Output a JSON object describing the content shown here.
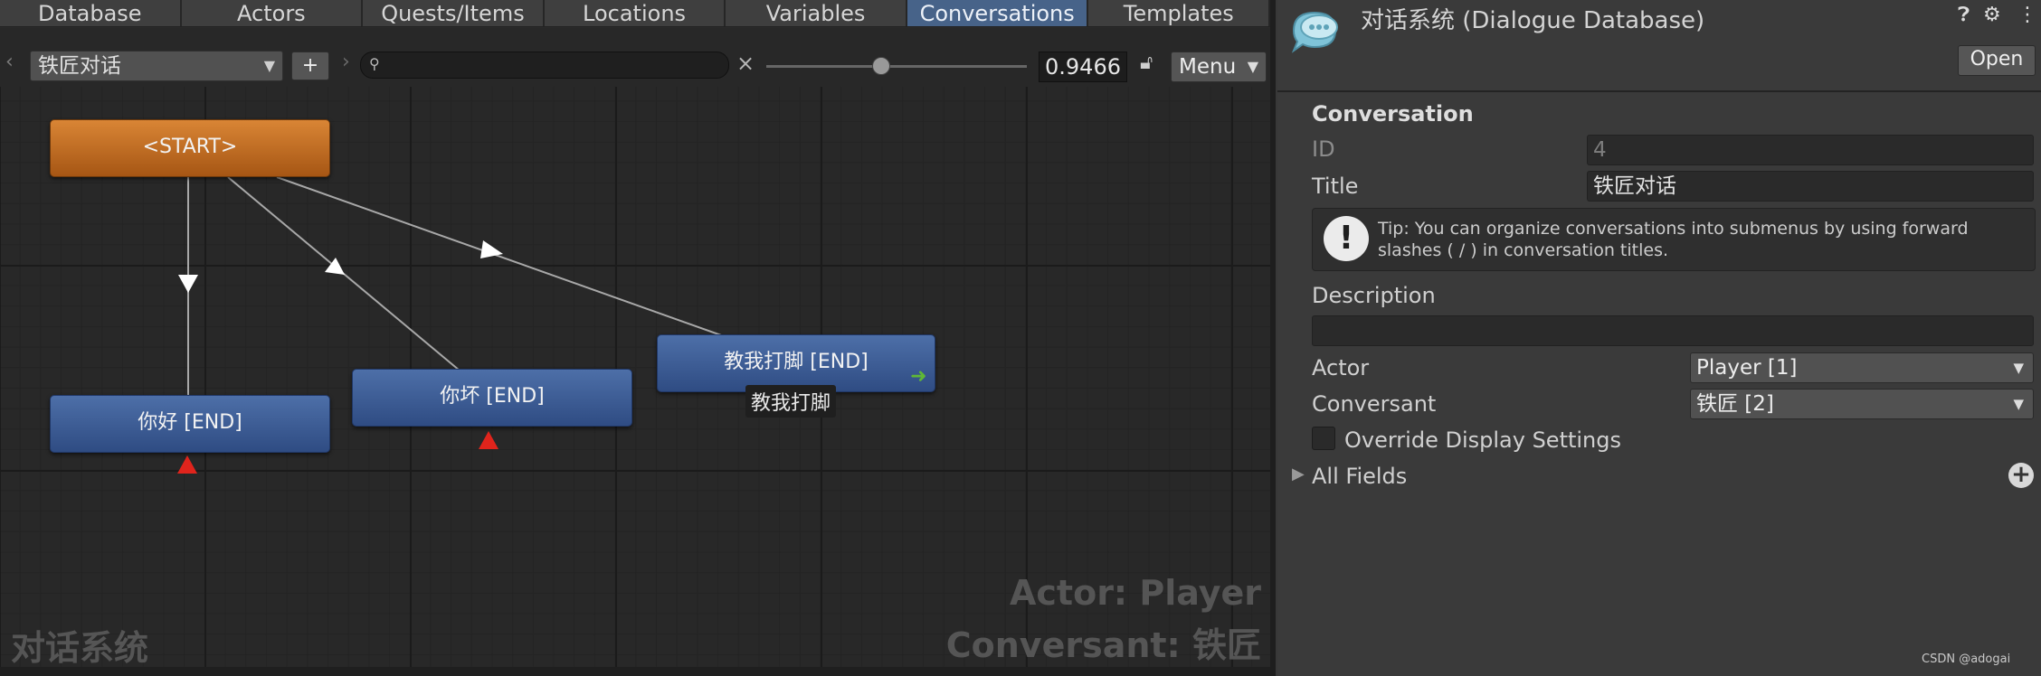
{
  "tabs": [
    "Database",
    "Actors",
    "Quests/Items",
    "Locations",
    "Variables",
    "Conversations",
    "Templates"
  ],
  "active_tab": "Conversations",
  "toolbar": {
    "conversation_title": "铁匠对话",
    "add_label": "+",
    "search_value": "",
    "clear_label": "×",
    "zoom_value": "0.9466",
    "zoom_fraction": 0.44,
    "menu_label": "Menu"
  },
  "canvas": {
    "nodes": [
      {
        "id": "start",
        "label": "<START>",
        "kind": "start"
      },
      {
        "id": "n1",
        "label": "你好 [END]",
        "kind": "end"
      },
      {
        "id": "n2",
        "label": "你坏 [END]",
        "kind": "end"
      },
      {
        "id": "n3",
        "label": "教我打脚 [END]",
        "kind": "end"
      }
    ],
    "node_caption": "教我打脚",
    "watermark_left": "对话系统",
    "actor_line": "Actor: Player",
    "conversant_line": "Conversant: 铁匠"
  },
  "inspector": {
    "database_title": "对话系统 (Dialogue Database)",
    "open_label": "Open",
    "section_title": "Conversation",
    "id_label": "ID",
    "id_value": "4",
    "title_label": "Title",
    "title_value": "铁匠对话",
    "tip": "Tip: You can organize conversations into submenus by using forward slashes ( / ) in conversation titles.",
    "description_label": "Description",
    "description_value": "",
    "actor_label": "Actor",
    "actor_value": "Player [1]",
    "conversant_label": "Conversant",
    "conversant_value": "铁匠 [2]",
    "override_label": "Override Display Settings",
    "override_checked": false,
    "all_fields_label": "All Fields"
  },
  "credit": "CSDN @adogai",
  "colors": {
    "active_tab": "#476389",
    "start_node": "#c87428",
    "end_node": "#3e5d96",
    "end_marker": "#e0241c",
    "link_arrow": "#5fb836"
  }
}
